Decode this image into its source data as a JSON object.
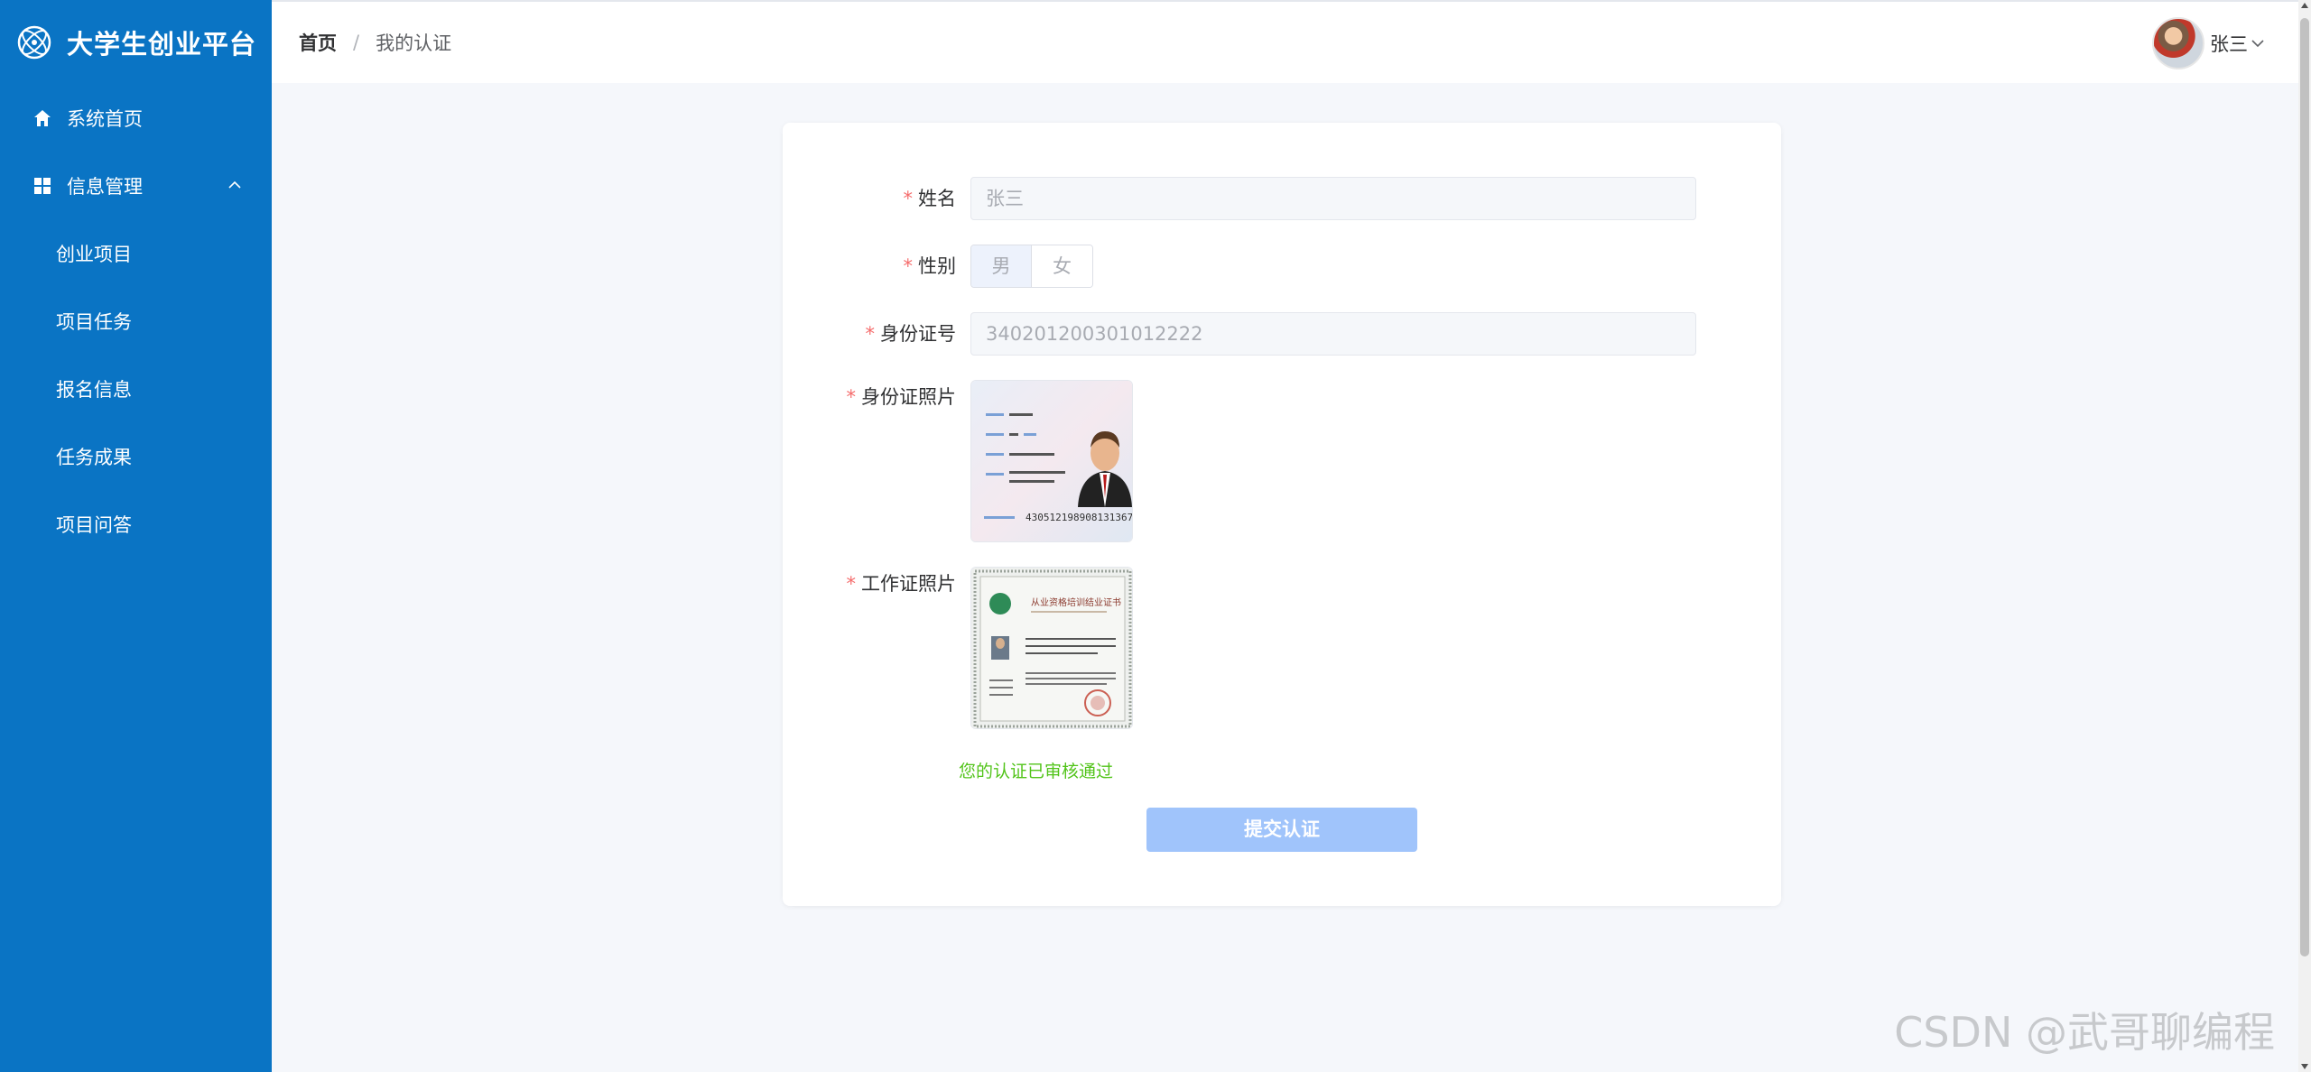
{
  "app": {
    "title": "大学生创业平台"
  },
  "sidebar": {
    "items": [
      {
        "label": "系统首页",
        "icon": "home-icon"
      },
      {
        "label": "信息管理",
        "icon": "grid-icon",
        "expanded": true,
        "children": [
          {
            "label": "创业项目"
          },
          {
            "label": "项目任务"
          },
          {
            "label": "报名信息"
          },
          {
            "label": "任务成果"
          },
          {
            "label": "项目问答"
          }
        ]
      }
    ]
  },
  "header": {
    "breadcrumb": {
      "home": "首页",
      "separator": "/",
      "current": "我的认证"
    },
    "user": {
      "name": "张三"
    }
  },
  "form": {
    "name": {
      "label": "姓名",
      "value": "张三"
    },
    "gender": {
      "label": "性别",
      "options": [
        "男",
        "女"
      ],
      "selected": "男"
    },
    "id_number": {
      "label": "身份证号",
      "value": "340201200301012222"
    },
    "id_photo": {
      "label": "身份证照片",
      "id_card_number": "430512198908131367"
    },
    "work_photo": {
      "label": "工作证照片",
      "cert_title": "从业资格培训结业证书"
    },
    "required_mark": "*",
    "status_text": "您的认证已审核通过",
    "submit_label": "提交认证"
  },
  "watermark": "CSDN @武哥聊编程",
  "colors": {
    "sidebar_bg": "#0a74c4",
    "required": "#f56c6c",
    "status": "#52c41a",
    "submit_disabled": "#a0c4fb"
  }
}
